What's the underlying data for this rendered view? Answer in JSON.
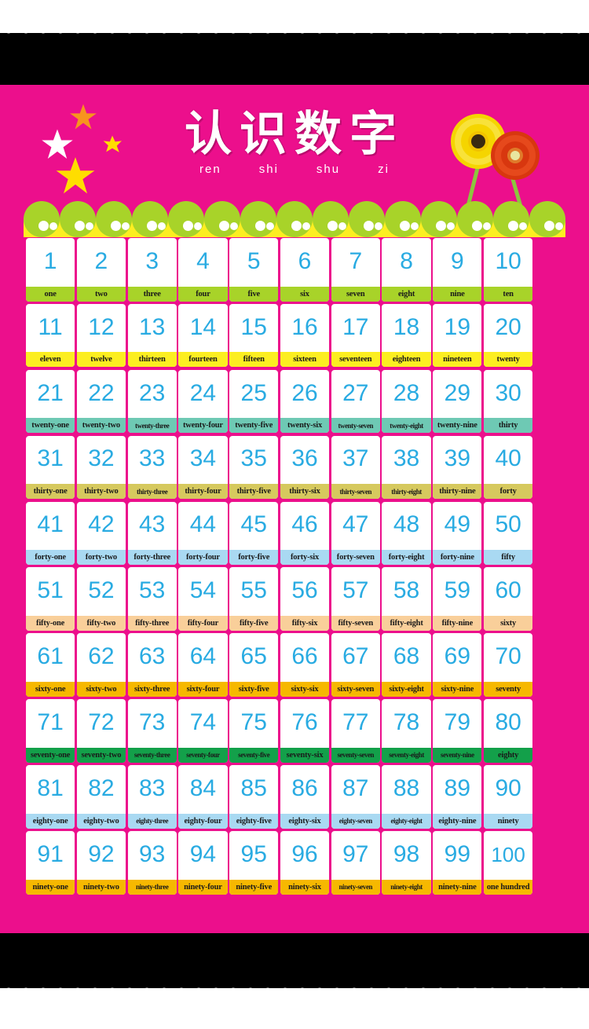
{
  "poster": {
    "title_chinese": "认识数字",
    "pinyin": [
      "ren",
      "shi",
      "shu",
      "zi"
    ],
    "colors": {
      "background_pink": "#ec0f8c",
      "number_blue": "#29abe2",
      "card_white": "#ffffff",
      "scallop_green": "#a8d329",
      "scallop_yellow": "#fcee21",
      "frame_black": "#000000"
    },
    "decorations": {
      "stars": [
        {
          "name": "orange-star",
          "color": "#f7941e"
        },
        {
          "name": "white-star",
          "color": "#ffffff"
        },
        {
          "name": "small-yellow-star",
          "color": "#ffdd00"
        },
        {
          "name": "large-yellow-star",
          "color": "#ffdd00"
        }
      ],
      "flowers": [
        {
          "name": "yellow-gerbera",
          "petal_color": "#f7e017",
          "center_color": "#3a2a10"
        },
        {
          "name": "red-gerbera",
          "petal_color": "#e03a16",
          "center_color": "#e8e6a0"
        }
      ]
    }
  },
  "grid": {
    "row_label_colors": [
      "#a8d329",
      "#fcee21",
      "#6ec9b4",
      "#d6c95e",
      "#a9d9f2",
      "#f9cf9a",
      "#f6b800",
      "#13a04a",
      "#a9d9f2",
      "#f6b800"
    ],
    "rows": [
      [
        {
          "n": "1",
          "w": "one"
        },
        {
          "n": "2",
          "w": "two"
        },
        {
          "n": "3",
          "w": "three"
        },
        {
          "n": "4",
          "w": "four"
        },
        {
          "n": "5",
          "w": "five"
        },
        {
          "n": "6",
          "w": "six"
        },
        {
          "n": "7",
          "w": "seven"
        },
        {
          "n": "8",
          "w": "eight"
        },
        {
          "n": "9",
          "w": "nine"
        },
        {
          "n": "10",
          "w": "ten"
        }
      ],
      [
        {
          "n": "11",
          "w": "eleven"
        },
        {
          "n": "12",
          "w": "twelve"
        },
        {
          "n": "13",
          "w": "thirteen"
        },
        {
          "n": "14",
          "w": "fourteen"
        },
        {
          "n": "15",
          "w": "fifteen"
        },
        {
          "n": "16",
          "w": "sixteen"
        },
        {
          "n": "17",
          "w": "seventeen"
        },
        {
          "n": "18",
          "w": "eighteen"
        },
        {
          "n": "19",
          "w": "nineteen"
        },
        {
          "n": "20",
          "w": "twenty"
        }
      ],
      [
        {
          "n": "21",
          "w": "twenty-one"
        },
        {
          "n": "22",
          "w": "twenty-two"
        },
        {
          "n": "23",
          "w": "twenty-three"
        },
        {
          "n": "24",
          "w": "twenty-four"
        },
        {
          "n": "25",
          "w": "twenty-five"
        },
        {
          "n": "26",
          "w": "twenty-six"
        },
        {
          "n": "27",
          "w": "twenty-seven"
        },
        {
          "n": "28",
          "w": "twenty-eight"
        },
        {
          "n": "29",
          "w": "twenty-nine"
        },
        {
          "n": "30",
          "w": "thirty"
        }
      ],
      [
        {
          "n": "31",
          "w": "thirty-one"
        },
        {
          "n": "32",
          "w": "thirty-two"
        },
        {
          "n": "33",
          "w": "thirty-three"
        },
        {
          "n": "34",
          "w": "thirty-four"
        },
        {
          "n": "35",
          "w": "thirty-five"
        },
        {
          "n": "36",
          "w": "thirty-six"
        },
        {
          "n": "37",
          "w": "thirty-seven"
        },
        {
          "n": "38",
          "w": "thirty-eight"
        },
        {
          "n": "39",
          "w": "thirty-nine"
        },
        {
          "n": "40",
          "w": "forty"
        }
      ],
      [
        {
          "n": "41",
          "w": "forty-one"
        },
        {
          "n": "42",
          "w": "forty-two"
        },
        {
          "n": "43",
          "w": "forty-three"
        },
        {
          "n": "44",
          "w": "forty-four"
        },
        {
          "n": "45",
          "w": "forty-five"
        },
        {
          "n": "46",
          "w": "forty-six"
        },
        {
          "n": "47",
          "w": "forty-seven"
        },
        {
          "n": "48",
          "w": "forty-eight"
        },
        {
          "n": "49",
          "w": "forty-nine"
        },
        {
          "n": "50",
          "w": "fifty"
        }
      ],
      [
        {
          "n": "51",
          "w": "fifty-one"
        },
        {
          "n": "52",
          "w": "fifty-two"
        },
        {
          "n": "53",
          "w": "fifty-three"
        },
        {
          "n": "54",
          "w": "fifty-four"
        },
        {
          "n": "55",
          "w": "fifty-five"
        },
        {
          "n": "56",
          "w": "fifty-six"
        },
        {
          "n": "57",
          "w": "fifty-seven"
        },
        {
          "n": "58",
          "w": "fifty-eight"
        },
        {
          "n": "59",
          "w": "fifty-nine"
        },
        {
          "n": "60",
          "w": "sixty"
        }
      ],
      [
        {
          "n": "61",
          "w": "sixty-one"
        },
        {
          "n": "62",
          "w": "sixty-two"
        },
        {
          "n": "63",
          "w": "sixty-three"
        },
        {
          "n": "64",
          "w": "sixty-four"
        },
        {
          "n": "65",
          "w": "sixty-five"
        },
        {
          "n": "66",
          "w": "sixty-six"
        },
        {
          "n": "67",
          "w": "sixty-seven"
        },
        {
          "n": "68",
          "w": "sixty-eight"
        },
        {
          "n": "69",
          "w": "sixty-nine"
        },
        {
          "n": "70",
          "w": "seventy"
        }
      ],
      [
        {
          "n": "71",
          "w": "seventy-one"
        },
        {
          "n": "72",
          "w": "seventy-two"
        },
        {
          "n": "73",
          "w": "seventy-three"
        },
        {
          "n": "74",
          "w": "seventy-four"
        },
        {
          "n": "75",
          "w": "seventy-five"
        },
        {
          "n": "76",
          "w": "seventy-six"
        },
        {
          "n": "77",
          "w": "seventy-seven"
        },
        {
          "n": "78",
          "w": "seventy-eight"
        },
        {
          "n": "79",
          "w": "seventy-nine"
        },
        {
          "n": "80",
          "w": "eighty"
        }
      ],
      [
        {
          "n": "81",
          "w": "eighty-one"
        },
        {
          "n": "82",
          "w": "eighty-two"
        },
        {
          "n": "83",
          "w": "eighty-three"
        },
        {
          "n": "84",
          "w": "eighty-four"
        },
        {
          "n": "85",
          "w": "eighty-five"
        },
        {
          "n": "86",
          "w": "eighty-six"
        },
        {
          "n": "87",
          "w": "eighty-seven"
        },
        {
          "n": "88",
          "w": "eighty-eight"
        },
        {
          "n": "89",
          "w": "eighty-nine"
        },
        {
          "n": "90",
          "w": "ninety"
        }
      ],
      [
        {
          "n": "91",
          "w": "ninety-one"
        },
        {
          "n": "92",
          "w": "ninety-two"
        },
        {
          "n": "93",
          "w": "ninety-three"
        },
        {
          "n": "94",
          "w": "ninety-four"
        },
        {
          "n": "95",
          "w": "ninety-five"
        },
        {
          "n": "96",
          "w": "ninety-six"
        },
        {
          "n": "97",
          "w": "ninety-seven"
        },
        {
          "n": "98",
          "w": "ninety-eight"
        },
        {
          "n": "99",
          "w": "ninety-nine"
        },
        {
          "n": "100",
          "w": "one hundred"
        }
      ]
    ]
  }
}
